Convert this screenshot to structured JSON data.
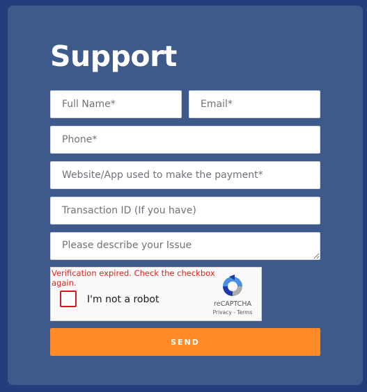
{
  "form": {
    "title": "Support",
    "fields": {
      "full_name": {
        "placeholder": "Full Name*",
        "value": ""
      },
      "email": {
        "placeholder": "Email*",
        "value": ""
      },
      "phone": {
        "placeholder": "Phone*",
        "value": ""
      },
      "website": {
        "placeholder": "Website/App used to make the payment*",
        "value": ""
      },
      "transaction_id": {
        "placeholder": "Transaction ID (If you have)",
        "value": ""
      },
      "issue": {
        "placeholder": "Please describe your Issue",
        "value": ""
      }
    },
    "send_label": "SEND"
  },
  "captcha": {
    "error": "Verification expired. Check the checkbox again.",
    "label": "I'm not a robot",
    "brand": "reCAPTCHA",
    "privacy": "Privacy",
    "separator": " - ",
    "terms": "Terms",
    "checked": false
  },
  "colors": {
    "page_background": "#223f7c",
    "card_background": "#3d5a8a",
    "accent": "#ff8a26",
    "error": "#e0221b"
  }
}
